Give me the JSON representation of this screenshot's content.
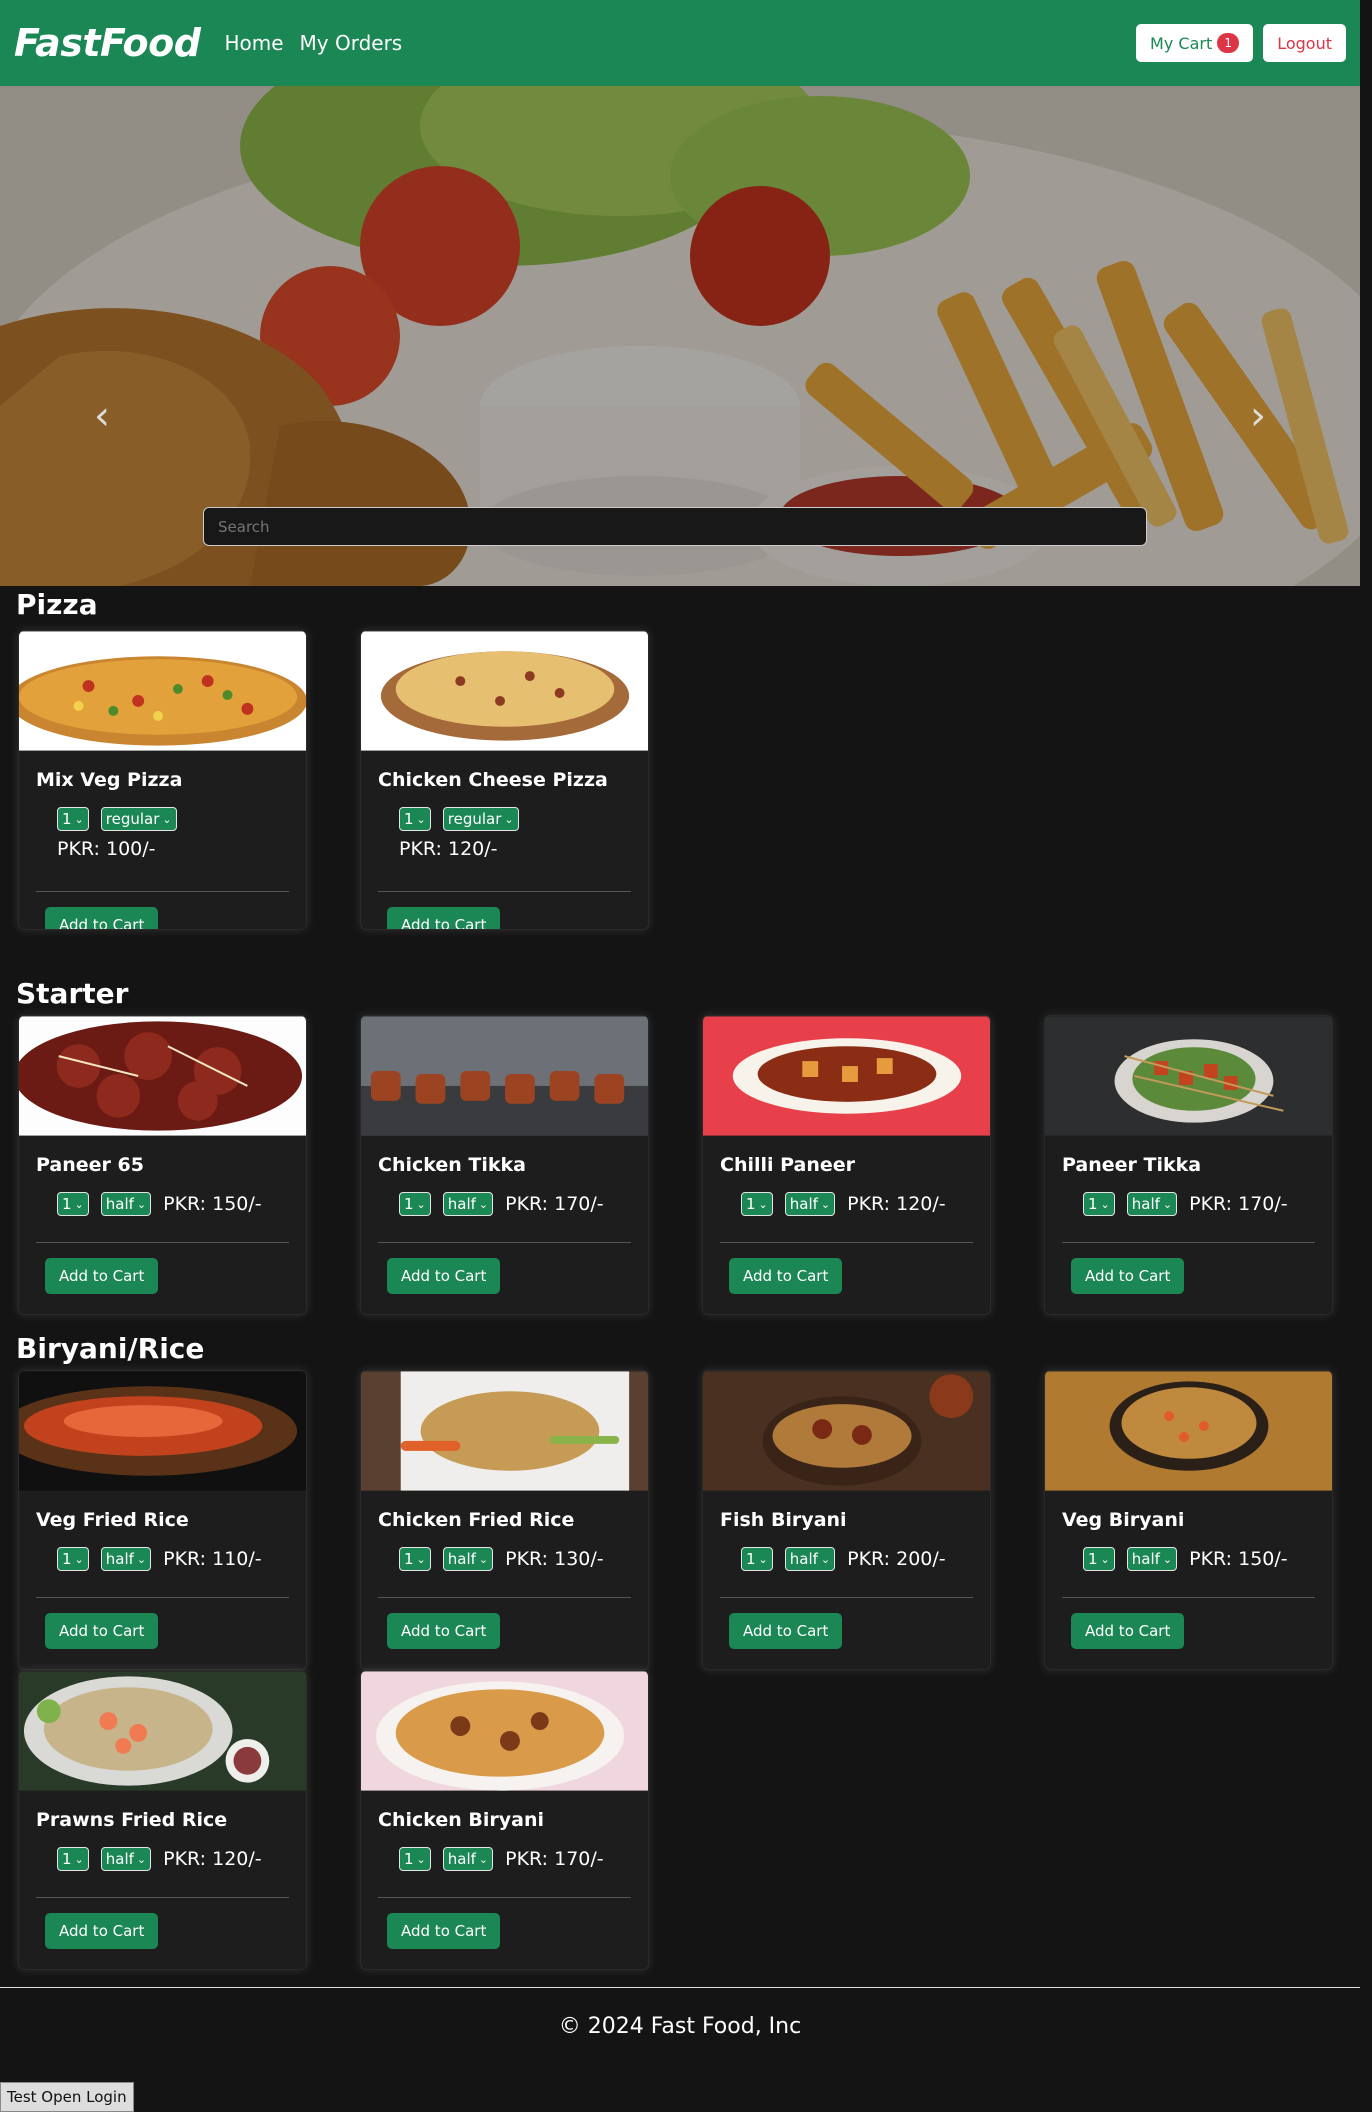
{
  "nav": {
    "brand": "FastFood",
    "links": [
      "Home",
      "My Orders"
    ],
    "cart_label": "My Cart",
    "cart_count": "1",
    "logout_label": "Logout"
  },
  "hero": {
    "prev_icon": "‹",
    "next_icon": "›",
    "search_placeholder": "Search"
  },
  "sections": [
    {
      "title": "Pizza",
      "items": [
        {
          "name": "Mix Veg Pizza",
          "qty": "1",
          "size": "regular",
          "price": "PKR: 100/-",
          "img": "pizza-veg"
        },
        {
          "name": "Chicken Cheese Pizza",
          "qty": "1",
          "size": "regular",
          "price": "PKR: 120/-",
          "img": "pizza-cheese"
        }
      ]
    },
    {
      "title": "Starter",
      "items": [
        {
          "name": "Paneer 65",
          "qty": "1",
          "size": "half",
          "price": "PKR: 150/-",
          "img": "paneer65"
        },
        {
          "name": "Chicken Tikka",
          "qty": "1",
          "size": "half",
          "price": "PKR: 170/-",
          "img": "tikka"
        },
        {
          "name": "Chilli Paneer",
          "qty": "1",
          "size": "half",
          "price": "PKR: 120/-",
          "img": "chilli"
        },
        {
          "name": "Paneer Tikka",
          "qty": "1",
          "size": "half",
          "price": "PKR: 170/-",
          "img": "ptikka"
        }
      ]
    },
    {
      "title": "Biryani/Rice",
      "items": [
        {
          "name": "Veg Fried Rice",
          "qty": "1",
          "size": "half",
          "price": "PKR: 110/-",
          "img": "vfr"
        },
        {
          "name": "Chicken Fried Rice",
          "qty": "1",
          "size": "half",
          "price": "PKR: 130/-",
          "img": "cfr"
        },
        {
          "name": "Fish Biryani",
          "qty": "1",
          "size": "half",
          "price": "PKR: 200/-",
          "img": "fish"
        },
        {
          "name": "Veg Biryani",
          "qty": "1",
          "size": "half",
          "price": "PKR: 150/-",
          "img": "vbir"
        },
        {
          "name": "Prawns Fried Rice",
          "qty": "1",
          "size": "half",
          "price": "PKR: 120/-",
          "img": "prawn"
        },
        {
          "name": "Chicken Biryani",
          "qty": "1",
          "size": "half",
          "price": "PKR: 170/-",
          "img": "cbir"
        }
      ]
    }
  ],
  "add_to_cart_label": "Add to Cart",
  "footer": {
    "copyright": "© 2024 Fast Food, Inc"
  },
  "test_button_label": "Test Open Login",
  "colors": {
    "brand_green": "#1a8754",
    "danger": "#dc3545",
    "background": "#141414"
  }
}
